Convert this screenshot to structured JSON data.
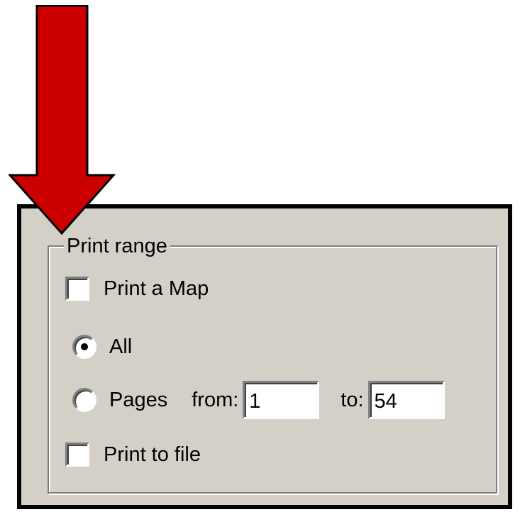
{
  "print_range": {
    "legend": "Print range",
    "print_map": {
      "label": "Print a Map",
      "checked": false
    },
    "all": {
      "label": "All",
      "selected": true
    },
    "pages": {
      "label": "Pages",
      "from_label": "from:",
      "from_value": "1",
      "to_label": "to:",
      "to_value": "54",
      "selected": false
    },
    "print_to_file": {
      "label": "Print to file",
      "checked": false
    }
  },
  "annotation": {
    "icon": "down-arrow-icon",
    "color": "#cc0000"
  },
  "colors": {
    "panel": "#d4d0c8",
    "border": "#000000"
  }
}
